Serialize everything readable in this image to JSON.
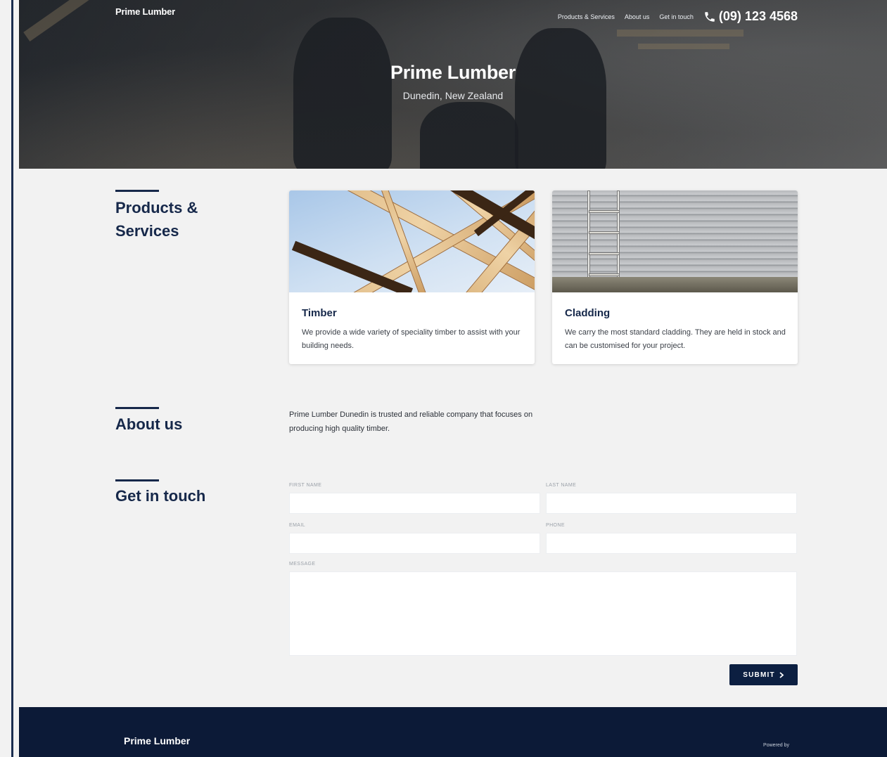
{
  "header": {
    "brand": "Prime Lumber",
    "nav": [
      "Products & Services",
      "About us",
      "Get in touch"
    ],
    "phone": "(09) 123 4568",
    "title": "Prime Lumber",
    "subtitle": "Dunedin, New Zealand"
  },
  "products": {
    "title": "Products & Services",
    "cards": [
      {
        "title": "Timber",
        "text": "We provide a wide variety of speciality timber to assist with your building needs."
      },
      {
        "title": "Cladding",
        "text": "We carry the most standard cladding. They are held in stock and can be customised for your project."
      }
    ]
  },
  "about": {
    "title": "About us",
    "text": "Prime Lumber Dunedin is trusted and reliable company that focuses on producing high quality timber."
  },
  "contact": {
    "title": "Get in touch",
    "labels": {
      "first": "FIRST NAME",
      "last": "LAST NAME",
      "email": "EMAIL",
      "phone": "PHONE",
      "message": "MESSAGE"
    },
    "submit": "SUBMIT"
  },
  "footer": {
    "brand": "Prime Lumber",
    "powered": "Powered by"
  },
  "colors": {
    "navy": "#16284a",
    "footer": "#0c1a37",
    "button": "#0c1f41"
  }
}
